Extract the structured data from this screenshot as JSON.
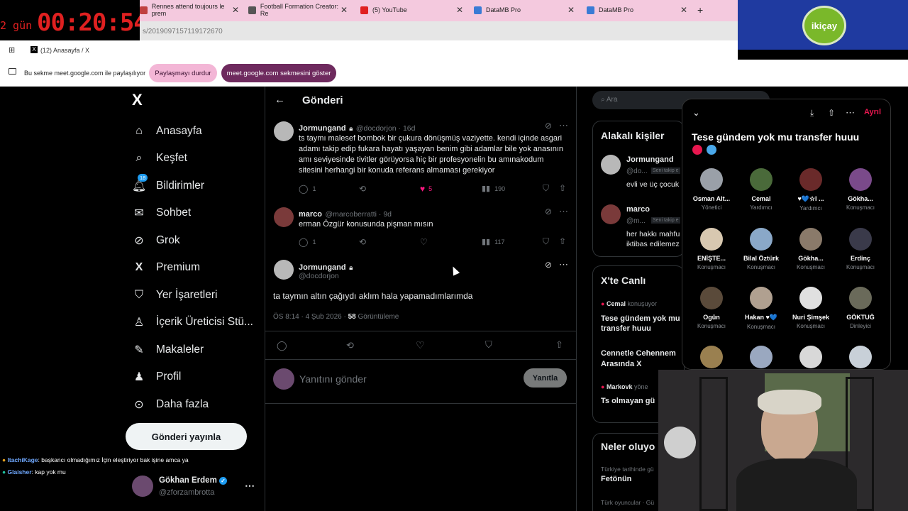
{
  "timer": {
    "days": "2 gün",
    "time": "00:20:54"
  },
  "browser_tabs": [
    {
      "label": "Rennes attend toujours le prem"
    },
    {
      "label": "Football Formation Creator: Re"
    },
    {
      "label": "(5) YouTube"
    },
    {
      "label": "DataMB Pro"
    },
    {
      "label": "DataMB Pro"
    }
  ],
  "address_bar": {
    "url": "s/2019097157119172670"
  },
  "bookmark": {
    "label": "(12) Anasayfa / X"
  },
  "logo": {
    "text": "ikiçay"
  },
  "share_bar": {
    "text": "Bu sekme meet.google.com ile paylaşılıyor",
    "stop_label": "Paylaşmayı durdur",
    "show_label": "meet.google.com sekmesini göster"
  },
  "nav": {
    "logo": "X",
    "items": [
      {
        "label": "Anasayfa",
        "icon": "home-icon"
      },
      {
        "label": "Keşfet",
        "icon": "search-icon"
      },
      {
        "label": "Bildirimler",
        "icon": "bell-icon",
        "badge": "18"
      },
      {
        "label": "Sohbet",
        "icon": "mail-icon"
      },
      {
        "label": "Grok",
        "icon": "grok-icon"
      },
      {
        "label": "Premium",
        "icon": "x-icon"
      },
      {
        "label": "Yer İşaretleri",
        "icon": "bookmark-icon"
      },
      {
        "label": "İçerik Üreticisi Stü...",
        "icon": "creator-icon"
      },
      {
        "label": "Makaleler",
        "icon": "article-icon"
      },
      {
        "label": "Profil",
        "icon": "profile-icon"
      },
      {
        "label": "Daha fazla",
        "icon": "more-icon"
      }
    ],
    "post_button": "Gönderi yayınla"
  },
  "chat": [
    {
      "user": "ItachiKage",
      "msg": ": başkancı olmadığımız İçin eleştiriyor bak işine amca ya"
    },
    {
      "user": "Glaisher",
      "msg": ": kap yok mu"
    }
  ],
  "account": {
    "name": "Gökhan Erdem",
    "handle": "@zforzambrotta"
  },
  "header": {
    "title": "Gönderi",
    "back": "←"
  },
  "tweets": [
    {
      "name": "Jormungand",
      "handle": "@docdorjon · 16d",
      "text": "ts taymı malesef bombok bir çukura dönüşmüş vaziyette. kendi içinde asgari adamı takip edip fukara hayatı yaşayan benim gibi adamlar bile yok anasının amı seviyesinde tivitler görüyorsa hiç bir profesyonelin bu amınakodum sitesini herhangi bir konuda referans almaması gerekiyor",
      "replies": "1",
      "likes": "5",
      "views": "190"
    },
    {
      "name": "marco",
      "handle": "@marcoberratti · 9d",
      "text": "erman Özgür konusunda pişman mısın",
      "replies": "1",
      "likes": "",
      "views": "117"
    }
  ],
  "main_tweet": {
    "name": "Jormungand",
    "handle": "@docdorjon",
    "text": "ta taymın altın çağıydı aklım hala yapamadımlarımda",
    "time": "ÖS 8:14 · 4 Şub 2026 ·",
    "views_count": "58",
    "views_label": "Görüntüleme"
  },
  "reply": {
    "placeholder": "Yanıtını gönder",
    "button": "Yanıtla"
  },
  "right": {
    "search_placeholder": "Ara",
    "related_title": "Alakalı kişiler",
    "related": [
      {
        "name": "Jormungand",
        "handle": "@do...",
        "tag": "Seni takip e",
        "bio": "evli ve üç çocuk"
      },
      {
        "name": "marco",
        "handle": "@m...",
        "tag": "Seni takip e",
        "bio": "her hakkı mahfu iktibas edilemez"
      }
    ],
    "live_title": "X'te Canlı",
    "live_host": "Cemal",
    "live_host_status": "konuşuyor",
    "live_space": "Tese gündem yok mu transfer huuu",
    "live_items": [
      {
        "title": "Cennetle Cehennem Arasında X"
      },
      {
        "host": "Markovk",
        "host_status": "yöne",
        "title": "Ts olmayan gü"
      }
    ],
    "trends_title": "Neler oluyo",
    "trends": [
      {
        "context": "Türkiye tarihinde gü",
        "title": "Fetönün"
      },
      {
        "context": "Türk oyuncular · Gü",
        "title": ""
      }
    ]
  },
  "space": {
    "leave": "Ayrıl",
    "title": "Tese gündem yok mu transfer huuu",
    "participants": [
      {
        "name": "Osman Alt...",
        "role": "Yönetici"
      },
      {
        "name": "Cemal",
        "role": "Yardımcı"
      },
      {
        "name": "♥💙☆I ...",
        "role": "Yardımcı"
      },
      {
        "name": "Gökha...",
        "role": "Konuşmacı"
      },
      {
        "name": "ENİŞTE...",
        "role": "Konuşmacı"
      },
      {
        "name": "Bilal Öztürk",
        "role": "Konuşmacı"
      },
      {
        "name": "Gökha...",
        "role": "Konuşmacı"
      },
      {
        "name": "Erdinç",
        "role": "Konuşmacı"
      },
      {
        "name": "Ogün",
        "role": "Konuşmacı"
      },
      {
        "name": "Hakan ♥💙",
        "role": "Konuşmacı"
      },
      {
        "name": "Nuri Şimşek",
        "role": "Konuşmacı"
      },
      {
        "name": "GÖKTUĞ",
        "role": "Dinleyici"
      }
    ]
  },
  "colors": {
    "accent": "#1d9bf0",
    "like": "#f91880",
    "share_pink": "#f3b6d6",
    "share_purple": "#6e2a5e",
    "space_red": "#e8174f"
  }
}
